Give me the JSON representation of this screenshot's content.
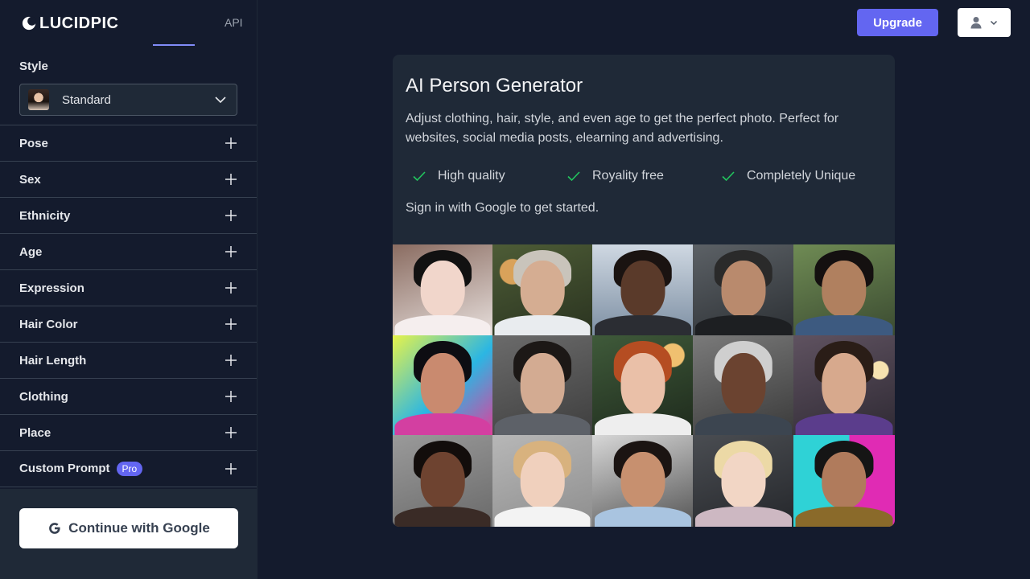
{
  "brand": {
    "logo_text": "LUCIDPIC"
  },
  "nav": {
    "api_label": "API"
  },
  "header": {
    "upgrade_label": "Upgrade"
  },
  "sidebar": {
    "style_label": "Style",
    "style_value": "Standard",
    "options": [
      {
        "label": "Pose"
      },
      {
        "label": "Sex"
      },
      {
        "label": "Ethnicity"
      },
      {
        "label": "Age"
      },
      {
        "label": "Expression"
      },
      {
        "label": "Hair Color"
      },
      {
        "label": "Hair Length"
      },
      {
        "label": "Clothing"
      },
      {
        "label": "Place"
      },
      {
        "label": "Custom Prompt",
        "badge": "Pro"
      }
    ],
    "google_button_label": "Continue with Google"
  },
  "card": {
    "title": "AI Person Generator",
    "description": "Adjust clothing, hair, style, and even age to get the perfect photo. Perfect for websites, social media posts, elearning and advertising.",
    "features": [
      "High quality",
      "Royality free",
      "Completely Unique"
    ],
    "signin_text": "Sign in with Google to get started."
  },
  "colors": {
    "accent": "#6366f1",
    "check": "#22c55e",
    "background": "#141b2d",
    "card": "#1f2937"
  },
  "icons": {
    "logo": "crescent-logo-icon",
    "expand": "plus-icon",
    "dropdown": "chevron-down-icon",
    "google": "google-g-icon",
    "user": "user-icon",
    "check": "check-icon"
  }
}
